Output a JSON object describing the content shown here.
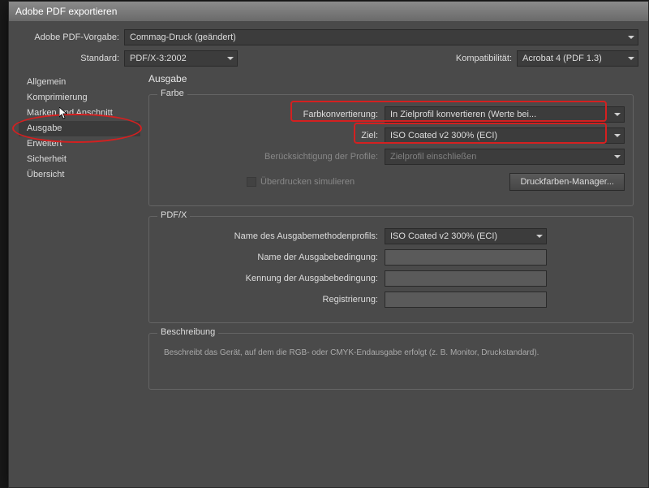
{
  "window": {
    "title": "Adobe PDF exportieren"
  },
  "top": {
    "preset_label": "Adobe PDF-Vorgabe:",
    "preset_value": "Commag-Druck (geändert)",
    "standard_label": "Standard:",
    "standard_value": "PDF/X-3:2002",
    "compat_label": "Kompatibilität:",
    "compat_value": "Acrobat 4 (PDF 1.3)"
  },
  "sidebar": {
    "items": [
      {
        "label": "Allgemein"
      },
      {
        "label": "Komprimierung"
      },
      {
        "label": "Marken und Anschnitt"
      },
      {
        "label": "Ausgabe",
        "selected": true
      },
      {
        "label": "Erweitert"
      },
      {
        "label": "Sicherheit"
      },
      {
        "label": "Übersicht"
      }
    ]
  },
  "main": {
    "title": "Ausgabe",
    "farbe": {
      "legend": "Farbe",
      "conv_label": "Farbkonvertierung:",
      "conv_value": "In Zielprofil konvertieren (Werte bei...",
      "ziel_label": "Ziel:",
      "ziel_value": "ISO Coated v2 300% (ECI)",
      "profile_label": "Berücksichtigung der Profile:",
      "profile_value": "Zielprofil einschließen",
      "overprint_label": "Überdrucken simulieren",
      "ink_manager": "Druckfarben-Manager..."
    },
    "pdfx": {
      "legend": "PDF/X",
      "outprofile_label": "Name des Ausgabemethodenprofils:",
      "outprofile_value": "ISO Coated v2 300% (ECI)",
      "outcond_label": "Name der Ausgabebedingung:",
      "outcond_id_label": "Kennung der Ausgabebedingung:",
      "registry_label": "Registrierung:"
    },
    "beschreibung": {
      "legend": "Beschreibung",
      "text": "Beschreibt das Gerät, auf dem die RGB- oder CMYK-Endausgabe erfolgt (z. B. Monitor, Druckstandard)."
    }
  }
}
